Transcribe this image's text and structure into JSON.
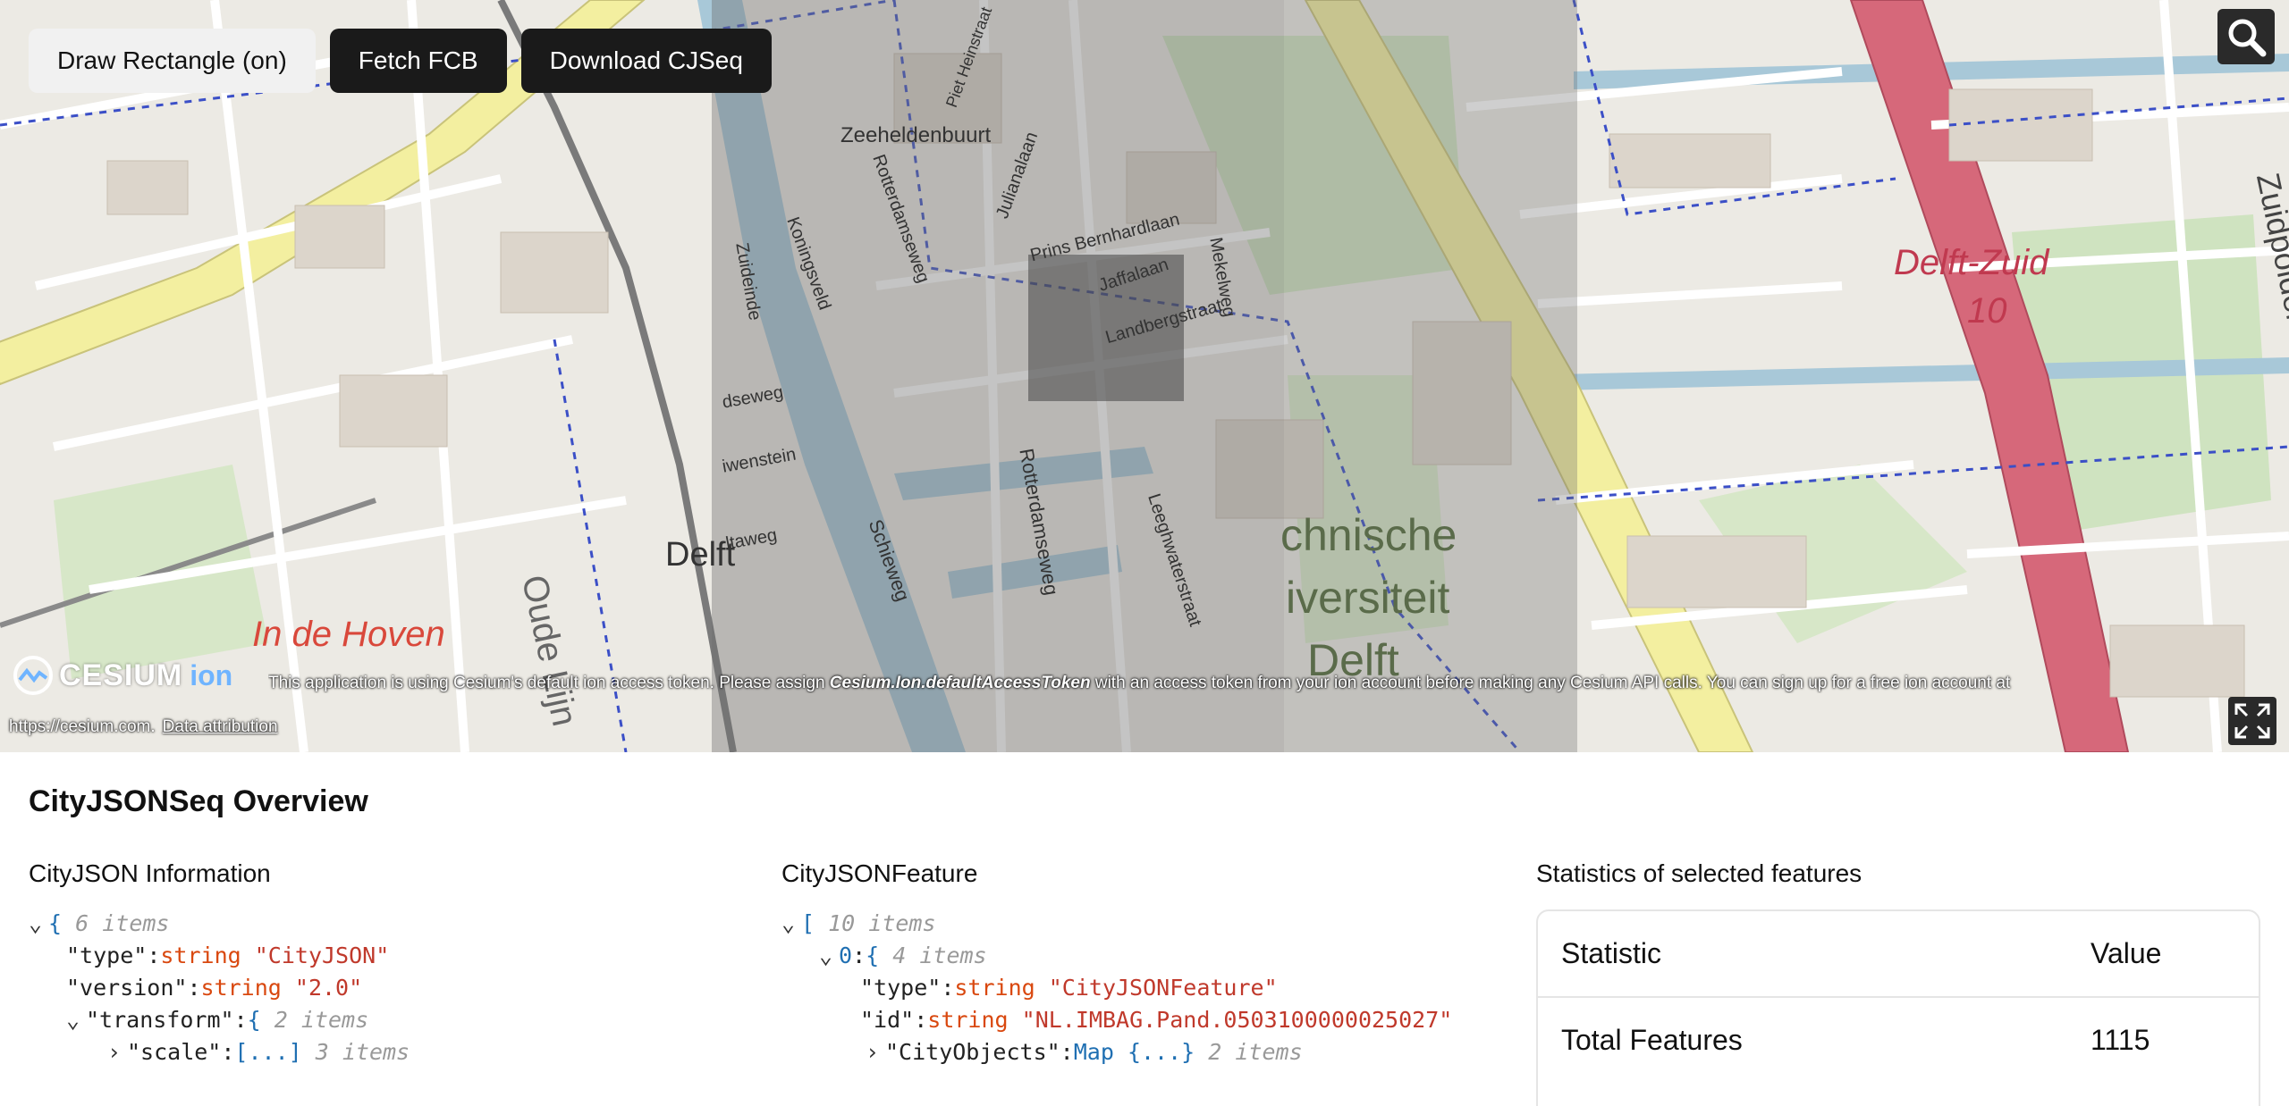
{
  "toolbar": {
    "draw_label": "Draw Rectangle (on)",
    "fetch_label": "Fetch FCB",
    "download_label": "Download CJSeq"
  },
  "map": {
    "labels": {
      "zeeheldenbuurt": "Zeeheldenbuurt",
      "delft_zuid": "Delft-Zuid",
      "delft_zuid_num": "10",
      "in_de_hoven": "In de Hoven",
      "tu_line1": "chnische",
      "tu_line2": "iversiteit",
      "tu_line3": "Delft",
      "oude_lijn": "Oude Lijn",
      "delft": "Delft",
      "rotterdamseweg": "Rotterdamseweg",
      "rotterdamseweg2": "Rotterdamseweg",
      "zuideinde": "Zuideinde",
      "koningsveld": "Koningsveld",
      "julianalaan": "Julianalaan",
      "piet_heinstraat": "Piet Heinstraat",
      "bernhardlaan": "Prins Bernhardlaan",
      "jaffalaan": "Jaffalaan",
      "landbergstraat": "Landbergstraat",
      "mekelweg": "Mekelweg",
      "leeghwaterstraat": "Leeghwaterstraat",
      "schieweg": "Schieweg",
      "dseweg": "dseweg",
      "wenstein": "iwenstein",
      "ltaweg": "ltaweg",
      "zuidpolder": "Zuidpolder"
    },
    "credits": {
      "logo_word": "CESIUM",
      "logo_ion": "ion",
      "text_before": "This application is using Cesium's default ion access token. Please assign ",
      "text_em": "Cesium.Ion.defaultAccessToken",
      "text_after": " with an access token from your ion account before making any Cesium API calls. You can sign up for a free ion account at",
      "line2": "https://cesium.com.",
      "data_attribution": "Data attribution"
    },
    "colors": {
      "background": "#ecebe6",
      "road": "#ffffff",
      "water": "#a8c8d8",
      "park": "#cfe3c0",
      "highway": "#d6687a",
      "primary": "#f3efa0",
      "boundary": "#3b4fc7"
    }
  },
  "panel": {
    "title": "CityJSONSeq Overview",
    "cityjson": {
      "heading": "CityJSON Information",
      "root_meta": "6 items",
      "rows": [
        {
          "key": "\"type\"",
          "type": "string",
          "value": "\"CityJSON\""
        },
        {
          "key": "\"version\"",
          "type": "string",
          "value": "\"2.0\""
        }
      ],
      "transform_key": "\"transform\"",
      "transform_meta": "2 items",
      "scale_key": "\"scale\"",
      "scale_value": "[...]",
      "scale_meta": "3 items"
    },
    "feature": {
      "heading": "CityJSONFeature",
      "root_meta": "10 items",
      "index_key": "0",
      "index_meta": "4 items",
      "rows": [
        {
          "key": "\"type\"",
          "type": "string",
          "value": "\"CityJSONFeature\""
        },
        {
          "key": "\"id\"",
          "type": "string",
          "value": "\"NL.IMBAG.Pand.0503100000025027\""
        }
      ],
      "cityobjects_key": "\"CityObjects\"",
      "cityobjects_type": "Map",
      "cityobjects_value": "{...}",
      "cityobjects_meta": "2 items"
    },
    "stats": {
      "heading": "Statistics of selected features",
      "col_statistic": "Statistic",
      "col_value": "Value",
      "rows": [
        {
          "statistic": "Total Features",
          "value": "1115"
        }
      ]
    }
  }
}
